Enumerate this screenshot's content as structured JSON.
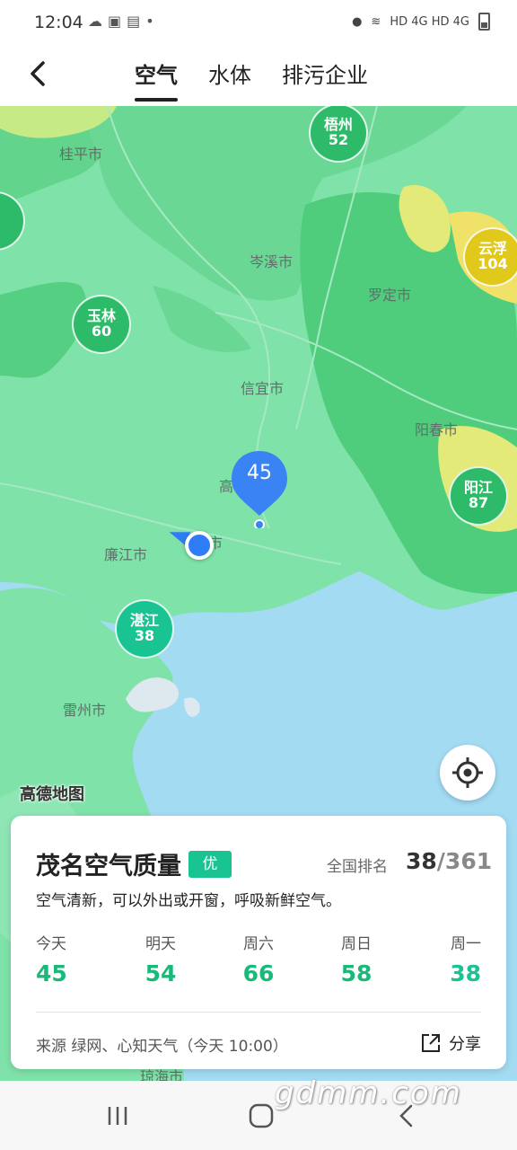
{
  "status_bar": {
    "time": "12:04",
    "left_icons": [
      "notification-icon",
      "image-icon",
      "document-icon",
      "dot-icon"
    ],
    "right_text": "HD 4G HD 4G"
  },
  "header": {
    "back_icon": "chevron-left-icon",
    "tabs": [
      {
        "label": "空气",
        "active": true
      },
      {
        "label": "水体",
        "active": false
      },
      {
        "label": "排污企业",
        "active": false
      }
    ]
  },
  "map": {
    "city_labels": [
      "桂平市",
      "岑溪市",
      "罗定市",
      "信宜市",
      "阳春市",
      "高",
      "市",
      "廉江市",
      "雷州市",
      "琼海市"
    ],
    "markers": [
      {
        "name": "梧州",
        "value": "52",
        "color": "#2dbb6a"
      },
      {
        "name": "云浮",
        "value": "104",
        "color": "#e0c91a"
      },
      {
        "name": "玉林",
        "value": "60",
        "color": "#2dbb6a"
      },
      {
        "name": "阳江",
        "value": "87",
        "color": "#2dbb6a"
      },
      {
        "name": "湛江",
        "value": "38",
        "color": "#19c392"
      }
    ],
    "pin_value": "45",
    "attribution": "高德地图"
  },
  "card": {
    "title": "茂名空气质量",
    "badge": "优",
    "rank_label": "全国排名",
    "rank": "38",
    "rank_total": "/361",
    "advice": "空气清新，可以外出或开窗，呼吸新鲜空气。",
    "forecast": [
      {
        "day": "今天",
        "value": "45"
      },
      {
        "day": "明天",
        "value": "54"
      },
      {
        "day": "周六",
        "value": "66"
      },
      {
        "day": "周日",
        "value": "58"
      },
      {
        "day": "周一",
        "value": "38"
      }
    ],
    "source": "来源 绿网、心知天气（今天 10:00）",
    "share_label": "分享"
  },
  "watermark": "gdmm.com",
  "colors": {
    "accent": "#19c392",
    "pin": "#3a83f4",
    "good": "#19b97a"
  }
}
